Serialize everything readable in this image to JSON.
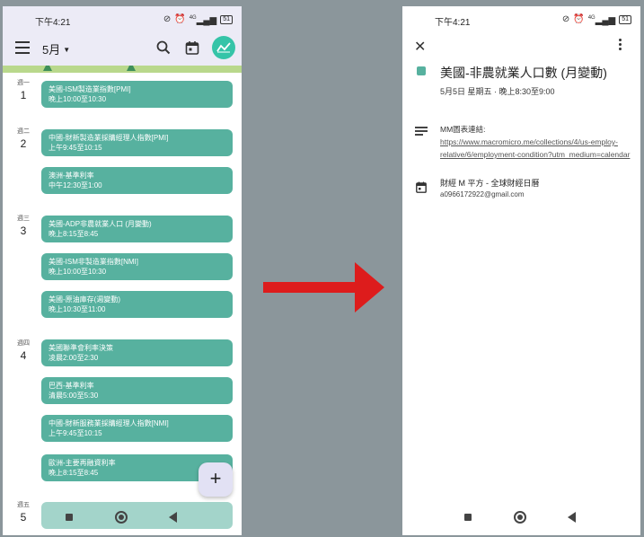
{
  "colors": {
    "event": "#57b19f",
    "appbar": "#ecebf6",
    "arrow": "#dd1c1c",
    "background": "#8b969b"
  },
  "status": {
    "time": "下午4:21",
    "battery": "51",
    "net": "4G"
  },
  "left": {
    "month": "5月",
    "icons": [
      "menu-icon",
      "search-icon",
      "calendar-icon",
      "avatar-icon"
    ],
    "days": [
      {
        "dow": "週一",
        "num": "1"
      },
      {
        "dow": "週二",
        "num": "2"
      },
      {
        "dow": "週三",
        "num": "3"
      },
      {
        "dow": "週四",
        "num": "4"
      },
      {
        "dow": "週五",
        "num": "5"
      }
    ],
    "events": [
      {
        "title": "美國-ISM製造業指數[PMI]",
        "time": "晚上10:00至10:30"
      },
      {
        "title": "中國-財新製造業採購經理人指數[PMI]",
        "time": "上午9:45至10:15"
      },
      {
        "title": "澳洲-基準利率",
        "time": "中午12:30至1:00"
      },
      {
        "title": "美國-ADP非農就業人口 (月變動)",
        "time": "晚上8:15至8:45"
      },
      {
        "title": "美國-ISM非製造業指數[NMI]",
        "time": "晚上10:00至10:30"
      },
      {
        "title": "美國-原油庫存(週變動)",
        "time": "晚上10:30至11:00"
      },
      {
        "title": "美國聯準會利率決策",
        "time": "凌晨2:00至2:30"
      },
      {
        "title": "巴西-基準利率",
        "time": "清晨5:00至5:30"
      },
      {
        "title": "中國-財新服務業採購經理人指數[NMI]",
        "time": "上午9:45至10:15"
      },
      {
        "title": "歐洲-主要再融資利率",
        "time": "晚上8:15至8:45"
      }
    ],
    "fab": "+"
  },
  "right": {
    "title": "美國-非農就業人口數 (月變動)",
    "datetime": "5月5日 星期五 · 晚上8:30至9:00",
    "notes_label": "MM圖表連結: ",
    "notes_link": "https://www.macromicro.me/collections/4/us-employ-relative/6/employment-condition?utm_medium=calendar",
    "calendar_name": "財經 M 平方 - 全球財經日曆",
    "calendar_email": "a0966172922@gmail.com"
  }
}
